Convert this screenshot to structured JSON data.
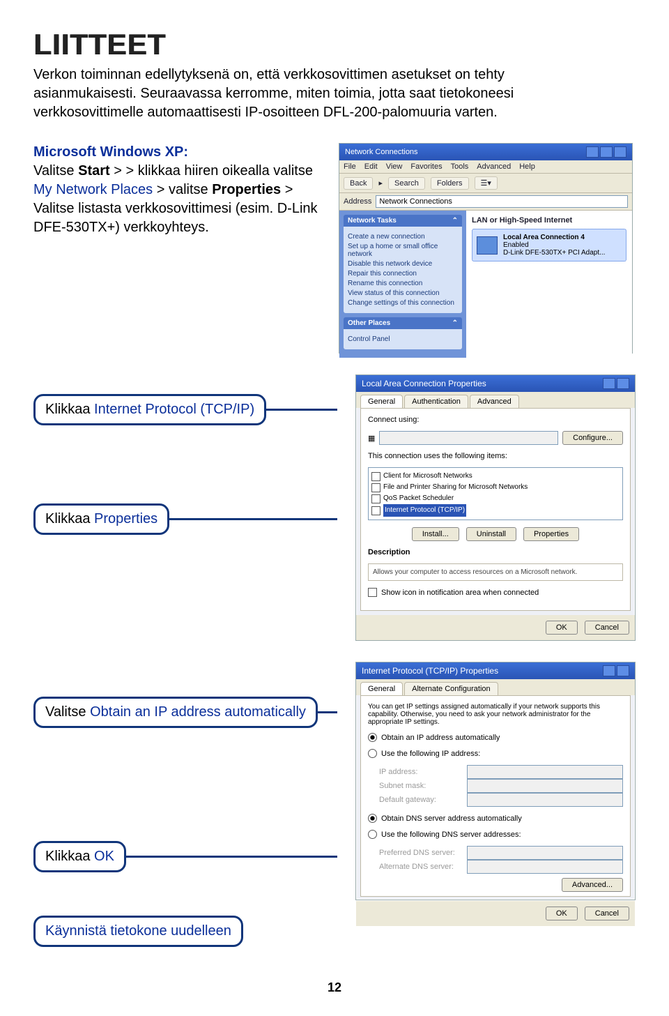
{
  "title": "LIITTEET",
  "intro": "Verkon toiminnan edellytyksenä on, että verkkosovittimen asetukset on tehty asianmukaisesti. Seuraavassa kerromme, miten toimia, jotta saat tietokoneesi verkkosovittimelle automaattisesti IP-osoitteen DFL-200-palomuuria varten.",
  "steps": {
    "heading": "Microsoft Windows XP:",
    "l1a": "Valitse ",
    "l1b": "Start",
    "l1c": " > > klikkaa hiiren oikealla valitse ",
    "l1d": "My Network Places",
    "l1e": "  > valitse  ",
    "l1f": "Properties",
    "l1g": " > Valitse listasta verkkosovittimesi (esim. D-Link DFE-530TX+) verkkoyhteys."
  },
  "nc": {
    "title": "Network Connections",
    "menu": [
      "File",
      "Edit",
      "View",
      "Favorites",
      "Tools",
      "Advanced",
      "Help"
    ],
    "toolbar": {
      "back": "Back",
      "search": "Search",
      "folders": "Folders"
    },
    "addr_label": "Address",
    "addr_value": "Network Connections",
    "pane_tasks": "Network Tasks",
    "tasks": [
      "Create a new connection",
      "Set up a home or small office network",
      "Disable this network device",
      "Repair this connection",
      "Rename this connection",
      "View status of this connection",
      "Change settings of this connection"
    ],
    "pane_other": "Other Places",
    "other": [
      "Control Panel"
    ],
    "group": "LAN or High-Speed Internet",
    "conn_name": "Local Area Connection 4",
    "conn_status": "Enabled",
    "conn_dev": "D-Link DFE-530TX+ PCI Adapt..."
  },
  "propdlg": {
    "title": "Local Area Connection Properties",
    "tabs": [
      "General",
      "Authentication",
      "Advanced"
    ],
    "connect_label": "Connect using:",
    "uses_label": "This connection uses the following items:",
    "items": [
      "Client for Microsoft Networks",
      "File and Printer Sharing for Microsoft Networks",
      "QoS Packet Scheduler",
      "Internet Protocol (TCP/IP)"
    ],
    "btns": [
      "Install...",
      "Uninstall",
      "Properties"
    ],
    "desc_label": "Description",
    "desc_text": "Allows your computer to access resources on a Microsoft network.",
    "show_icon": "Show icon in notification area when connected",
    "ok": "OK",
    "cancel": "Cancel",
    "configure": "Configure..."
  },
  "tcpdlg": {
    "title": "Internet Protocol (TCP/IP) Properties",
    "tabs": [
      "General",
      "Alternate Configuration"
    ],
    "blurb": "You can get IP settings assigned automatically if your network supports this capability. Otherwise, you need to ask your network administrator for the appropriate IP settings.",
    "r1": "Obtain an IP address automatically",
    "r2": "Use the following IP address:",
    "f1": "IP address:",
    "f2": "Subnet mask:",
    "f3": "Default gateway:",
    "r3": "Obtain DNS server address automatically",
    "r4": "Use the following DNS server addresses:",
    "f4": "Preferred DNS server:",
    "f5": "Alternate DNS server:",
    "adv": "Advanced...",
    "ok": "OK",
    "cancel": "Cancel"
  },
  "callouts": {
    "c1a": "Klikkaa ",
    "c1b": "Internet Protocol (TCP/IP)",
    "c2a": "Klikkaa ",
    "c2b": "Properties",
    "c3a": "Valitse ",
    "c3b": "Obtain an IP address automatically",
    "c4a": "Klikkaa ",
    "c4b": "OK",
    "c5": "Käynnistä tietokone uudelleen"
  },
  "pagenum": "12"
}
